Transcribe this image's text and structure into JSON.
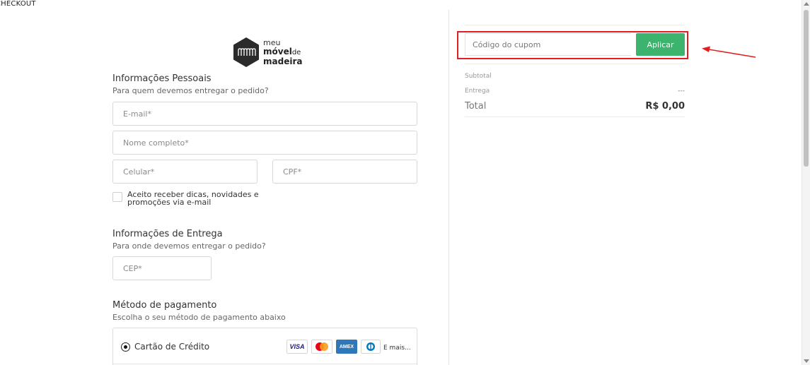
{
  "page": {
    "label": "CHECKOUT"
  },
  "brand": {
    "line1": "meu",
    "line2": "móvel",
    "line2_small": "de",
    "line3": "madeira",
    "hex_mark": "mmm"
  },
  "personal": {
    "title": "Informações Pessoais",
    "subtitle": "Para quem devemos entregar o pedido?",
    "email_placeholder": "E-mail*",
    "name_placeholder": "Nome completo*",
    "phone_placeholder": "Celular*",
    "cpf_placeholder": "CPF*",
    "newsletter_label": "Aceito receber dicas, novidades e promoções via e-mail",
    "newsletter_checked": false
  },
  "delivery": {
    "title": "Informações de Entrega",
    "subtitle": "Para onde devemos entregar o pedido?",
    "cep_placeholder": "CEP*"
  },
  "payment": {
    "title": "Método de pagamento",
    "subtitle": "Escolha o seu método de pagamento abaixo",
    "option_label": "Cartão de Crédito",
    "cards": [
      "VISA",
      "mastercard",
      "AMEX",
      "diners"
    ],
    "more_label": "E mais..."
  },
  "coupon": {
    "placeholder": "Código do cupom",
    "apply_label": "Aplicar"
  },
  "summary": {
    "subtotal_label": "Subtotal",
    "delivery_label": "Entrega",
    "delivery_value": "---",
    "total_label": "Total",
    "total_value": "R$ 0,00"
  },
  "colors": {
    "accent_green": "#3cb46e",
    "highlight_red": "#e02020",
    "logo_dark": "#2b2b2b"
  }
}
